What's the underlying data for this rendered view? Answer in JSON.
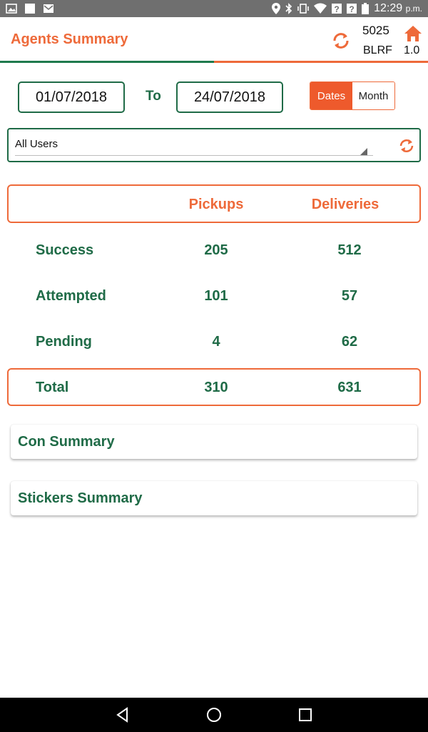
{
  "status_bar": {
    "time": "12:29",
    "time_suffix": "p.m.",
    "icons": [
      "image-icon",
      "square-icon",
      "mail-icon",
      "location-icon",
      "bluetooth-icon",
      "vibrate-icon",
      "wifi-icon",
      "no-signal-icon",
      "no-signal-icon",
      "battery-icon"
    ]
  },
  "header": {
    "title": "Agents Summary",
    "code_top": "5025",
    "code_bottom": "BLRF",
    "version": "1.0"
  },
  "filters": {
    "from_date": "01/07/2018",
    "to_label": "To",
    "to_date": "24/07/2018",
    "mode_dates": "Dates",
    "mode_month": "Month",
    "selected_mode": "Dates",
    "user_select": "All Users"
  },
  "summary": {
    "col_pickups": "Pickups",
    "col_deliveries": "Deliveries",
    "rows": [
      {
        "label": "Success",
        "pickups": "205",
        "deliveries": "512"
      },
      {
        "label": "Attempted",
        "pickups": "101",
        "deliveries": "57"
      },
      {
        "label": "Pending",
        "pickups": "4",
        "deliveries": "62"
      }
    ],
    "total": {
      "label": "Total",
      "pickups": "310",
      "deliveries": "631"
    }
  },
  "sections": {
    "con_summary": "Con Summary",
    "stickers_summary": "Stickers Summary"
  },
  "colors": {
    "accent_orange": "#ee6a3a",
    "accent_green": "#1f6b47",
    "status_bar": "#6f6f6f",
    "nav_bar": "#000000"
  }
}
